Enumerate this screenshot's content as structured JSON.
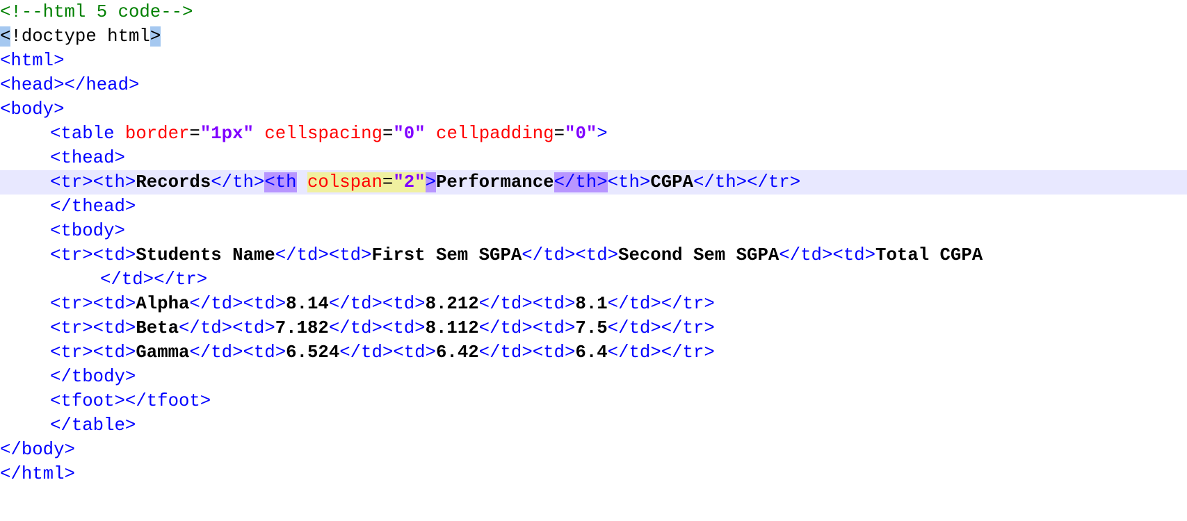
{
  "editor": {
    "language": "html",
    "colors": {
      "tag": "#0000ff",
      "attribute": "#ff0000",
      "string": "#8000ff",
      "comment": "#008000",
      "text": "#000000",
      "current_line": "#e8e8ff",
      "selection": "#a5c8f0",
      "brace_match": "#b896ff",
      "attr_match": "#f0f0a0"
    },
    "lines": {
      "l1": {
        "comment": "<!--html 5 code-->"
      },
      "l2": {
        "lt": "<",
        "bang": "!",
        "doctype": "doctype html",
        "gt": ">"
      },
      "l3": {
        "tag": "<html>"
      },
      "l4": {
        "tag": "<head></head>"
      },
      "l5": {
        "tag": "<body>"
      },
      "l6": {
        "open": "<table",
        "a1": "border",
        "eq1": "=",
        "q1": "\"",
        "v1": "1px",
        "q1e": "\"",
        "a2": "cellspacing",
        "eq2": "=",
        "v2": "\"0\"",
        "a3": "cellpadding",
        "eq3": "=",
        "v3": "\"0\"",
        "close": ">"
      },
      "l7": {
        "tag": "<thead>"
      },
      "l8": {
        "t1": "<tr><th>",
        "x1": "Records",
        "t2": "</th>",
        "t3": "<th",
        "a1": "colspan",
        "eq1": "=",
        "v1": "\"2\"",
        "t4": ">",
        "x2": "Performance",
        "t5": "</th>",
        "t6": "<th>",
        "x3": "CGPA",
        "t7": "</th></tr>"
      },
      "l9": {
        "tag": "</thead>"
      },
      "l10": {
        "tag": "<tbody>"
      },
      "l11": {
        "t1": "<tr><td>",
        "x1": "Students Name",
        "t2": "</td><td>",
        "x2": "First Sem SGPA",
        "t3": "</td><td>",
        "x3": "Second Sem SGPA",
        "t4": "</td><td>",
        "x4": "Total CGPA"
      },
      "l12": {
        "tag": "</td></tr>"
      },
      "l13": {
        "t1": "<tr><td>",
        "x1": "Alpha",
        "t2": "</td><td>",
        "x2": "8.14",
        "t3": "</td><td>",
        "x3": "8.212",
        "t4": "</td><td>",
        "x4": "8.1",
        "t5": "</td></tr>"
      },
      "l14": {
        "t1": "<tr><td>",
        "x1": "Beta",
        "t2": "</td><td>",
        "x2": "7.182",
        "t3": "</td><td>",
        "x3": "8.112",
        "t4": "</td><td>",
        "x4": "7.5",
        "t5": "</td></tr>"
      },
      "l15": {
        "t1": "<tr><td>",
        "x1": "Gamma",
        "t2": "</td><td>",
        "x2": "6.524",
        "t3": "</td><td>",
        "x3": "6.42",
        "t4": "</td><td>",
        "x4": "6.4",
        "t5": "</td></tr>"
      },
      "l16": {
        "tag": "</tbody>"
      },
      "l17": {
        "tag": "<tfoot></tfoot>"
      },
      "l18": {
        "tag": "</table>"
      },
      "l19": {
        "tag": "</body>"
      },
      "l20": {
        "tag": "</html>"
      }
    }
  }
}
